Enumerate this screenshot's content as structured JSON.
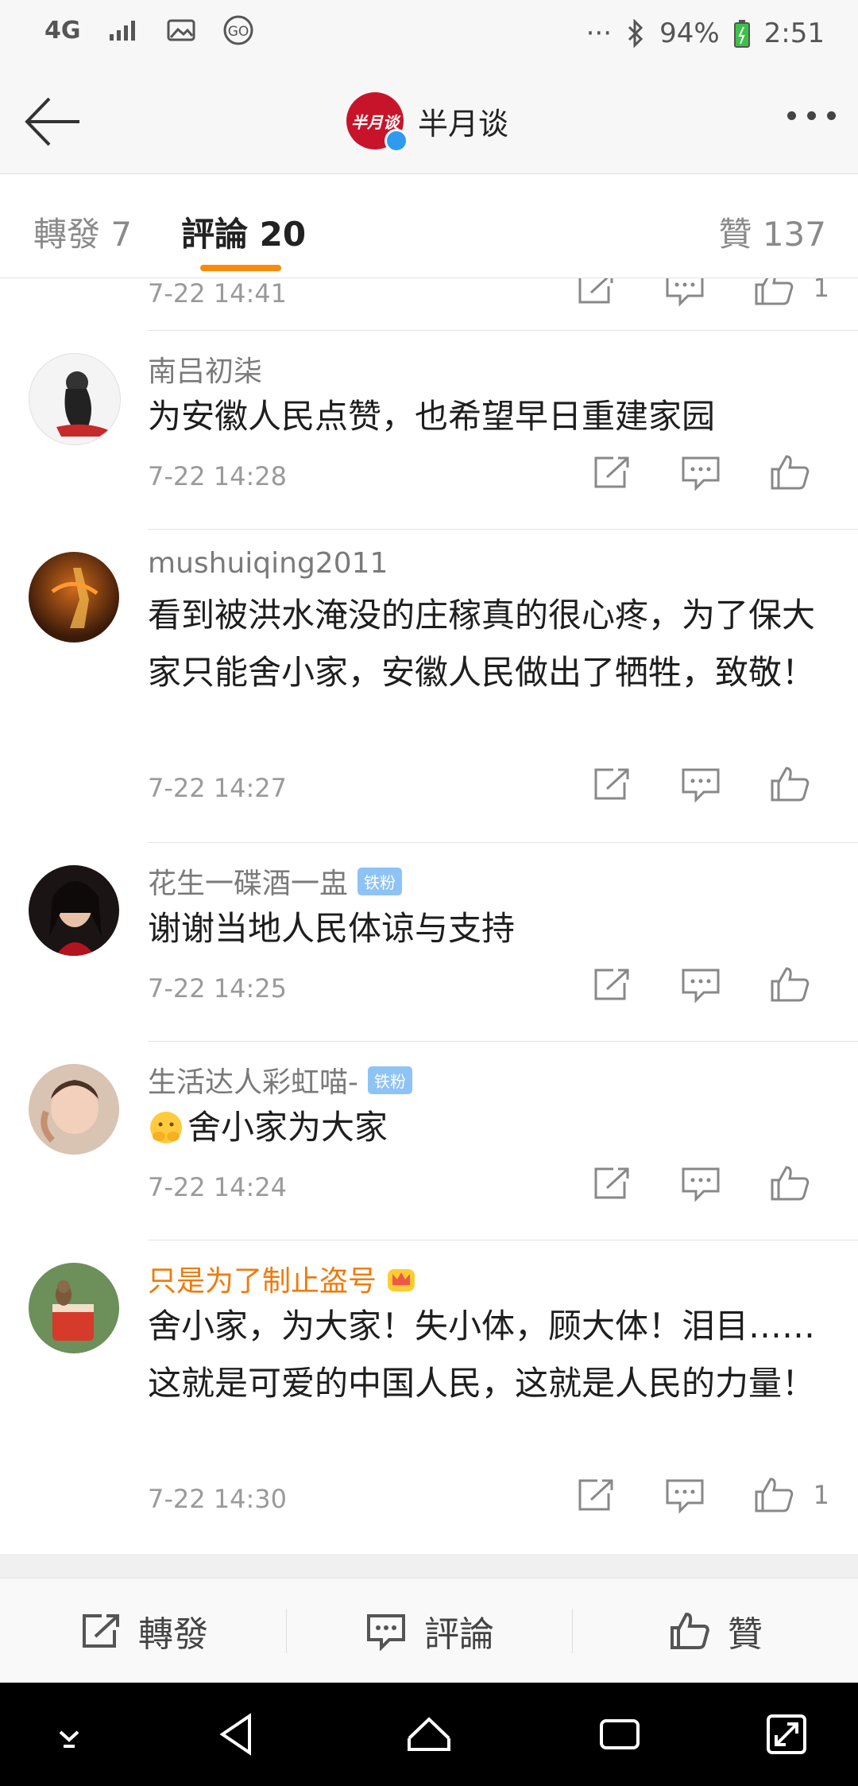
{
  "status_bar": {
    "network": "4G",
    "battery": "94%",
    "time": "2:51",
    "icons": [
      "signal-icon",
      "image-icon",
      "go-icon",
      "dots-icon",
      "bluetooth-icon",
      "battery-icon"
    ]
  },
  "header": {
    "title": "半月谈",
    "logo_text": "半月谈"
  },
  "tabs": {
    "repost": "轉發 7",
    "comment": "評論 20",
    "like": "贊 137"
  },
  "comments": [
    {
      "time": "7-22 14:41",
      "likes": "1"
    },
    {
      "username": "南吕初柒",
      "badge": "",
      "text": "为安徽人民点赞，也希望早日重建家园",
      "time": "7-22 14:28",
      "likes": ""
    },
    {
      "username": "mushuiqing2011",
      "badge": "",
      "text": "看到被洪水淹没的庄稼真的很心疼，为了保大家只能舍小家，安徽人民做出了牺牲，致敬！",
      "time": "7-22 14:27",
      "likes": ""
    },
    {
      "username": "花生一碟酒一盅",
      "badge": "铁粉",
      "text": "谢谢当地人民体谅与支持",
      "time": "7-22 14:25",
      "likes": ""
    },
    {
      "username": "生活达人彩虹喵-",
      "badge": "铁粉",
      "text": "舍小家为大家",
      "time": "7-22 14:24",
      "likes": ""
    },
    {
      "username": "只是为了制止盗号",
      "badge": "",
      "text": "舍小家，为大家！失小体，顾大体！泪目……这就是可爱的中国人民，这就是人民的力量！",
      "time": "7-22 14:30",
      "likes": "1"
    }
  ],
  "bottom_bar": {
    "repost": "轉發",
    "comment": "評論",
    "like": "贊"
  },
  "colors": {
    "accent": "#fa8a0b",
    "brand_red": "#c8142a",
    "vip_name": "#f07a0a",
    "badge_blue": "#8ec3f5"
  }
}
